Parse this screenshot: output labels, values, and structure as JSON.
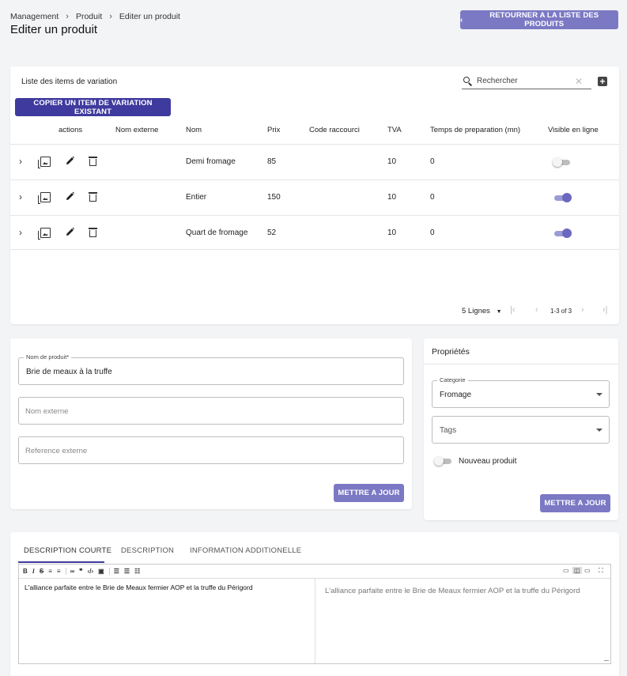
{
  "breadcrumb": {
    "items": [
      "Management",
      "Produit",
      "Editer un produit"
    ]
  },
  "page": {
    "title": "Editer un produit",
    "back_label": "RETOURNER A LA LISTE DES PRODUITS"
  },
  "variation": {
    "title": "Liste des items de variation",
    "search_placeholder": "Rechercher",
    "copy_label": "COPIER UN ITEM DE VARIATION EXISTANT",
    "columns": [
      "actions",
      "Nom externe",
      "Nom",
      "Prix",
      "Code raccourci",
      "TVA",
      "Temps de preparation (mn)",
      "Visible en ligne"
    ],
    "rows": [
      {
        "nom_externe": "",
        "nom": "Demi fromage",
        "prix": "85",
        "code": "",
        "tva": "10",
        "temps": "0",
        "visible": false
      },
      {
        "nom_externe": "",
        "nom": "Entier",
        "prix": "150",
        "code": "",
        "tva": "10",
        "temps": "0",
        "visible": true
      },
      {
        "nom_externe": "",
        "nom": "Quart de fromage",
        "prix": "52",
        "code": "",
        "tva": "10",
        "temps": "0",
        "visible": true
      }
    ],
    "pager": {
      "rows_per_page": "5 Lignes",
      "range": "1-3 of 3"
    }
  },
  "form": {
    "name_label": "Nom de produit*",
    "name_value": "Brie de meaux à la truffe",
    "external_name_placeholder": "Nom externe",
    "external_ref_placeholder": "Reference externe",
    "update_label": "METTRE A JOUR"
  },
  "props": {
    "title": "Propriétés",
    "category_label": "Categorie",
    "category_value": "Fromage",
    "tags_placeholder": "Tags",
    "new_product_label": "Nouveau produit",
    "new_product_on": false,
    "update_label": "METTRE A JOUR"
  },
  "description": {
    "tabs": [
      "DESCRIPTION COURTE",
      "DESCRIPTION",
      "INFORMATION ADDITIONELLE"
    ],
    "active_tab": 0,
    "editor_text": "L'alliance parfaite entre le Brie de Meaux fermier AOP et la truffe du Périgord",
    "preview_text": "L'alliance parfaite entre le Brie de Meaux fermier AOP et la truffe du Périgord"
  }
}
